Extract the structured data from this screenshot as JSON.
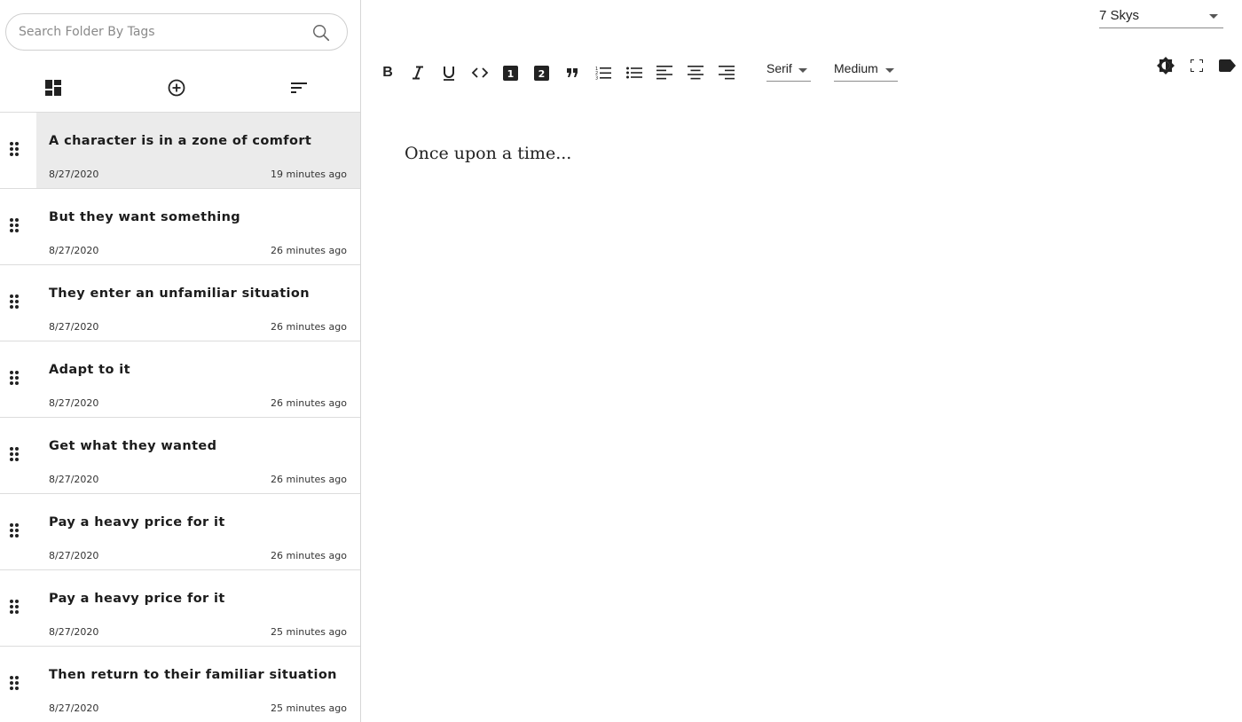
{
  "search": {
    "placeholder": "Search Folder By Tags"
  },
  "sidebar_actions": [
    {
      "icon": "dashboard-icon"
    },
    {
      "icon": "add-circle-icon"
    },
    {
      "icon": "sort-icon"
    }
  ],
  "notes": [
    {
      "title": "A character is in a zone of comfort",
      "date": "8/27/2020",
      "ago": "19 minutes ago",
      "selected": true
    },
    {
      "title": "But they want something",
      "date": "8/27/2020",
      "ago": "26 minutes ago"
    },
    {
      "title": "They enter an unfamiliar situation",
      "date": "8/27/2020",
      "ago": "26 minutes ago"
    },
    {
      "title": "Adapt to it",
      "date": "8/27/2020",
      "ago": "26 minutes ago"
    },
    {
      "title": "Get what they wanted",
      "date": "8/27/2020",
      "ago": "26 minutes ago"
    },
    {
      "title": "Pay a heavy price for it",
      "date": "8/27/2020",
      "ago": "26 minutes ago"
    },
    {
      "title": "Pay a heavy price for it",
      "date": "8/27/2020",
      "ago": "25 minutes ago"
    },
    {
      "title": "Then return to their familiar situation",
      "date": "8/27/2020",
      "ago": "25 minutes ago"
    }
  ],
  "folder": {
    "selected": "7 Skys"
  },
  "toolbar": {
    "bold": "B",
    "font_family": "Serif",
    "font_size": "Medium"
  },
  "colors": {
    "selected_row": "#ebebeb",
    "divider": "#dcdcdc",
    "icon": "#222222"
  },
  "document": {
    "text": "Once upon a time..."
  }
}
